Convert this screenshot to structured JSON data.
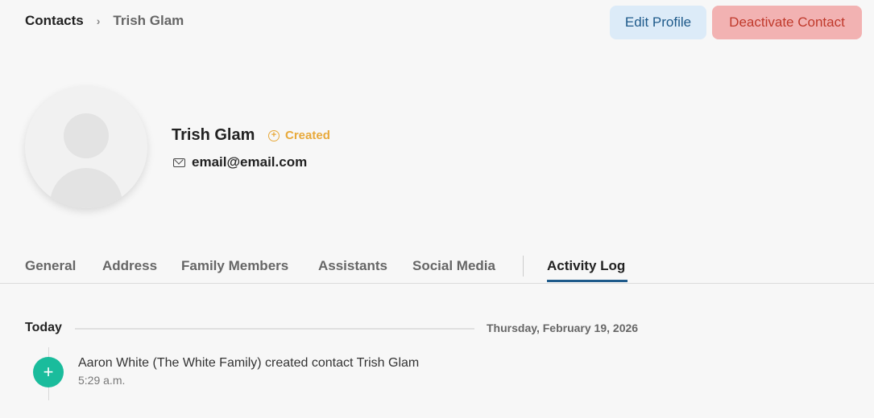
{
  "breadcrumb": {
    "root": "Contacts",
    "separator": "›",
    "current": "Trish Glam"
  },
  "actions": {
    "edit_label": "Edit Profile",
    "deactivate_label": "Deactivate Contact"
  },
  "profile": {
    "name": "Trish Glam",
    "status": "Created",
    "email": "email@email.com"
  },
  "tabs": [
    {
      "label": "General"
    },
    {
      "label": "Address"
    },
    {
      "label": "Family Members"
    },
    {
      "label": "Assistants"
    },
    {
      "label": "Social Media"
    },
    {
      "label": "Activity Log"
    }
  ],
  "activity": {
    "day_label": "Today",
    "day_date": "Thursday, February 19, 2026",
    "events": [
      {
        "text": "Aaron White (The White Family) created contact Trish Glam",
        "time": "5:29 a.m."
      }
    ]
  },
  "colors": {
    "accent": "#1e5a8a",
    "status_created": "#e8a93a",
    "danger": "#c0392b",
    "event_dot": "#1abc9c"
  },
  "icons": {
    "status": "plus-circle-icon",
    "email": "mail-icon",
    "event": "plus-icon",
    "avatar": "user-placeholder-icon"
  },
  "active_tab": "Activity Log"
}
